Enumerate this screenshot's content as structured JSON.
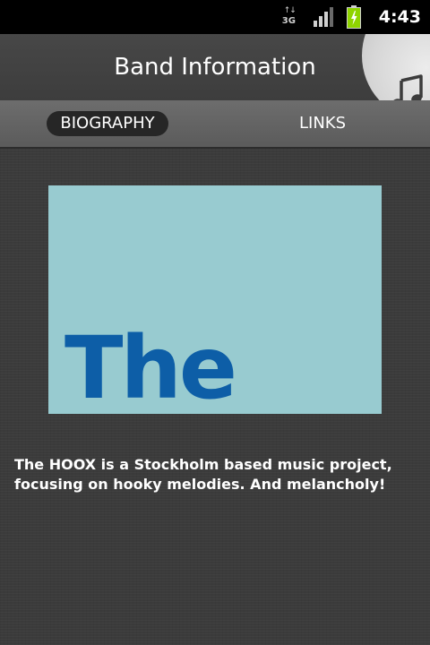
{
  "status_bar": {
    "network_arrows": "↑↓",
    "network_type": "3G",
    "time": "4:43",
    "icons": [
      "network-3g-icon",
      "signal-icon",
      "battery-icon"
    ]
  },
  "header": {
    "title": "Band Information",
    "action_icon": "music-note-icon"
  },
  "tabs": [
    {
      "label": "BIOGRAPHY",
      "selected": true
    },
    {
      "label": "LINKS",
      "selected": false
    }
  ],
  "band": {
    "image_text": "The",
    "description": "The HOOX is a Stockholm based music project, focusing on hooky melodies. And melancholy!"
  },
  "colors": {
    "status_bar": "#000000",
    "background": "#3b3b3b",
    "tab_bar": "#636363",
    "selected_tab": "#262626",
    "image_background": "#98cbd0",
    "image_text": "#0d5ea7",
    "battery": "#8fd400"
  }
}
